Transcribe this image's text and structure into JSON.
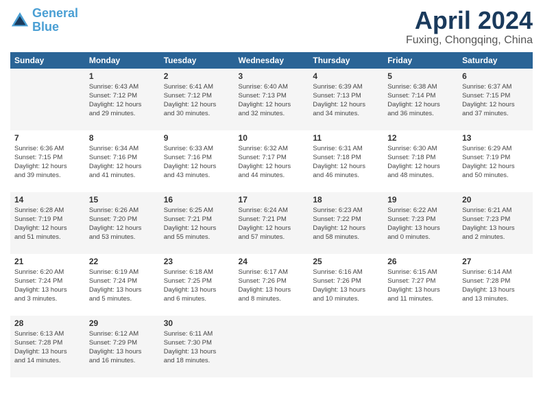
{
  "logo": {
    "line1": "General",
    "line2": "Blue"
  },
  "title": "April 2024",
  "subtitle": "Fuxing, Chongqing, China",
  "days_of_week": [
    "Sunday",
    "Monday",
    "Tuesday",
    "Wednesday",
    "Thursday",
    "Friday",
    "Saturday"
  ],
  "weeks": [
    [
      {
        "day": "",
        "info": ""
      },
      {
        "day": "1",
        "info": "Sunrise: 6:43 AM\nSunset: 7:12 PM\nDaylight: 12 hours\nand 29 minutes."
      },
      {
        "day": "2",
        "info": "Sunrise: 6:41 AM\nSunset: 7:12 PM\nDaylight: 12 hours\nand 30 minutes."
      },
      {
        "day": "3",
        "info": "Sunrise: 6:40 AM\nSunset: 7:13 PM\nDaylight: 12 hours\nand 32 minutes."
      },
      {
        "day": "4",
        "info": "Sunrise: 6:39 AM\nSunset: 7:13 PM\nDaylight: 12 hours\nand 34 minutes."
      },
      {
        "day": "5",
        "info": "Sunrise: 6:38 AM\nSunset: 7:14 PM\nDaylight: 12 hours\nand 36 minutes."
      },
      {
        "day": "6",
        "info": "Sunrise: 6:37 AM\nSunset: 7:15 PM\nDaylight: 12 hours\nand 37 minutes."
      }
    ],
    [
      {
        "day": "7",
        "info": "Sunrise: 6:36 AM\nSunset: 7:15 PM\nDaylight: 12 hours\nand 39 minutes."
      },
      {
        "day": "8",
        "info": "Sunrise: 6:34 AM\nSunset: 7:16 PM\nDaylight: 12 hours\nand 41 minutes."
      },
      {
        "day": "9",
        "info": "Sunrise: 6:33 AM\nSunset: 7:16 PM\nDaylight: 12 hours\nand 43 minutes."
      },
      {
        "day": "10",
        "info": "Sunrise: 6:32 AM\nSunset: 7:17 PM\nDaylight: 12 hours\nand 44 minutes."
      },
      {
        "day": "11",
        "info": "Sunrise: 6:31 AM\nSunset: 7:18 PM\nDaylight: 12 hours\nand 46 minutes."
      },
      {
        "day": "12",
        "info": "Sunrise: 6:30 AM\nSunset: 7:18 PM\nDaylight: 12 hours\nand 48 minutes."
      },
      {
        "day": "13",
        "info": "Sunrise: 6:29 AM\nSunset: 7:19 PM\nDaylight: 12 hours\nand 50 minutes."
      }
    ],
    [
      {
        "day": "14",
        "info": "Sunrise: 6:28 AM\nSunset: 7:19 PM\nDaylight: 12 hours\nand 51 minutes."
      },
      {
        "day": "15",
        "info": "Sunrise: 6:26 AM\nSunset: 7:20 PM\nDaylight: 12 hours\nand 53 minutes."
      },
      {
        "day": "16",
        "info": "Sunrise: 6:25 AM\nSunset: 7:21 PM\nDaylight: 12 hours\nand 55 minutes."
      },
      {
        "day": "17",
        "info": "Sunrise: 6:24 AM\nSunset: 7:21 PM\nDaylight: 12 hours\nand 57 minutes."
      },
      {
        "day": "18",
        "info": "Sunrise: 6:23 AM\nSunset: 7:22 PM\nDaylight: 12 hours\nand 58 minutes."
      },
      {
        "day": "19",
        "info": "Sunrise: 6:22 AM\nSunset: 7:23 PM\nDaylight: 13 hours\nand 0 minutes."
      },
      {
        "day": "20",
        "info": "Sunrise: 6:21 AM\nSunset: 7:23 PM\nDaylight: 13 hours\nand 2 minutes."
      }
    ],
    [
      {
        "day": "21",
        "info": "Sunrise: 6:20 AM\nSunset: 7:24 PM\nDaylight: 13 hours\nand 3 minutes."
      },
      {
        "day": "22",
        "info": "Sunrise: 6:19 AM\nSunset: 7:24 PM\nDaylight: 13 hours\nand 5 minutes."
      },
      {
        "day": "23",
        "info": "Sunrise: 6:18 AM\nSunset: 7:25 PM\nDaylight: 13 hours\nand 6 minutes."
      },
      {
        "day": "24",
        "info": "Sunrise: 6:17 AM\nSunset: 7:26 PM\nDaylight: 13 hours\nand 8 minutes."
      },
      {
        "day": "25",
        "info": "Sunrise: 6:16 AM\nSunset: 7:26 PM\nDaylight: 13 hours\nand 10 minutes."
      },
      {
        "day": "26",
        "info": "Sunrise: 6:15 AM\nSunset: 7:27 PM\nDaylight: 13 hours\nand 11 minutes."
      },
      {
        "day": "27",
        "info": "Sunrise: 6:14 AM\nSunset: 7:28 PM\nDaylight: 13 hours\nand 13 minutes."
      }
    ],
    [
      {
        "day": "28",
        "info": "Sunrise: 6:13 AM\nSunset: 7:28 PM\nDaylight: 13 hours\nand 14 minutes."
      },
      {
        "day": "29",
        "info": "Sunrise: 6:12 AM\nSunset: 7:29 PM\nDaylight: 13 hours\nand 16 minutes."
      },
      {
        "day": "30",
        "info": "Sunrise: 6:11 AM\nSunset: 7:30 PM\nDaylight: 13 hours\nand 18 minutes."
      },
      {
        "day": "",
        "info": ""
      },
      {
        "day": "",
        "info": ""
      },
      {
        "day": "",
        "info": ""
      },
      {
        "day": "",
        "info": ""
      }
    ]
  ]
}
